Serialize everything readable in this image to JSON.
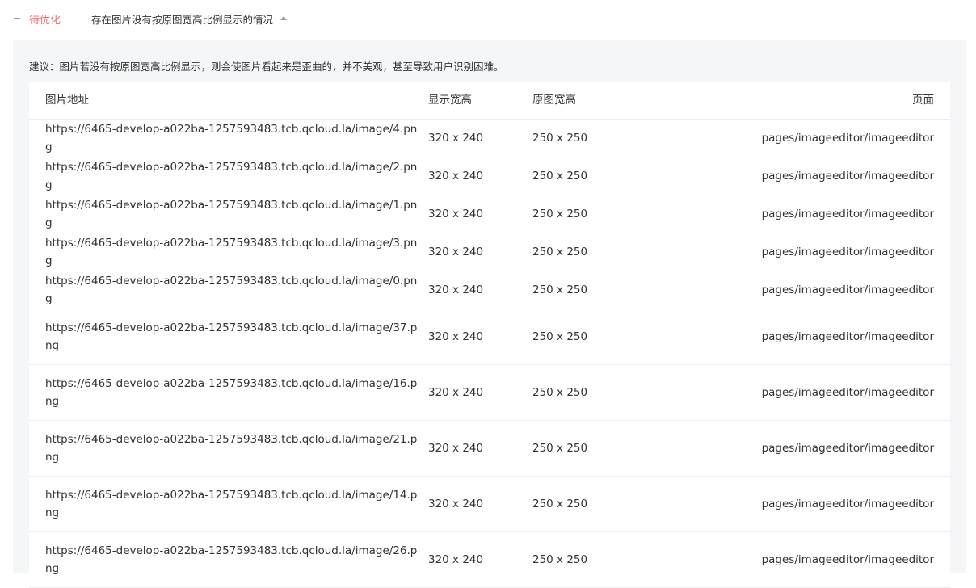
{
  "header": {
    "toggle_symbol": "−",
    "status": "待优化",
    "title": "存在图片没有按原图宽高比例显示的情况"
  },
  "advice": "建议：图片若没有按原图宽高比例显示，则会使图片看起来是歪曲的，并不美观，甚至导致用户识别困难。",
  "table": {
    "columns": {
      "url": "图片地址",
      "display_size": "显示宽高",
      "original_size": "原图宽高",
      "page": "页面"
    },
    "rows": [
      {
        "url": "https://6465-develop-a022ba-1257593483.tcb.qcloud.la/image/4.png",
        "display_size": "320 x 240",
        "original_size": "250 x 250",
        "page": "pages/imageeditor/imageeditor"
      },
      {
        "url": "https://6465-develop-a022ba-1257593483.tcb.qcloud.la/image/2.png",
        "display_size": "320 x 240",
        "original_size": "250 x 250",
        "page": "pages/imageeditor/imageeditor"
      },
      {
        "url": "https://6465-develop-a022ba-1257593483.tcb.qcloud.la/image/1.png",
        "display_size": "320 x 240",
        "original_size": "250 x 250",
        "page": "pages/imageeditor/imageeditor"
      },
      {
        "url": "https://6465-develop-a022ba-1257593483.tcb.qcloud.la/image/3.png",
        "display_size": "320 x 240",
        "original_size": "250 x 250",
        "page": "pages/imageeditor/imageeditor"
      },
      {
        "url": "https://6465-develop-a022ba-1257593483.tcb.qcloud.la/image/0.png",
        "display_size": "320 x 240",
        "original_size": "250 x 250",
        "page": "pages/imageeditor/imageeditor"
      },
      {
        "url": "https://6465-develop-a022ba-1257593483.tcb.qcloud.la/image/37.png",
        "display_size": "320 x 240",
        "original_size": "250 x 250",
        "page": "pages/imageeditor/imageeditor"
      },
      {
        "url": "https://6465-develop-a022ba-1257593483.tcb.qcloud.la/image/16.png",
        "display_size": "320 x 240",
        "original_size": "250 x 250",
        "page": "pages/imageeditor/imageeditor"
      },
      {
        "url": "https://6465-develop-a022ba-1257593483.tcb.qcloud.la/image/21.png",
        "display_size": "320 x 240",
        "original_size": "250 x 250",
        "page": "pages/imageeditor/imageeditor"
      },
      {
        "url": "https://6465-develop-a022ba-1257593483.tcb.qcloud.la/image/14.png",
        "display_size": "320 x 240",
        "original_size": "250 x 250",
        "page": "pages/imageeditor/imageeditor"
      },
      {
        "url": "https://6465-develop-a022ba-1257593483.tcb.qcloud.la/image/26.png",
        "display_size": "320 x 240",
        "original_size": "250 x 250",
        "page": "pages/imageeditor/imageeditor"
      }
    ]
  }
}
